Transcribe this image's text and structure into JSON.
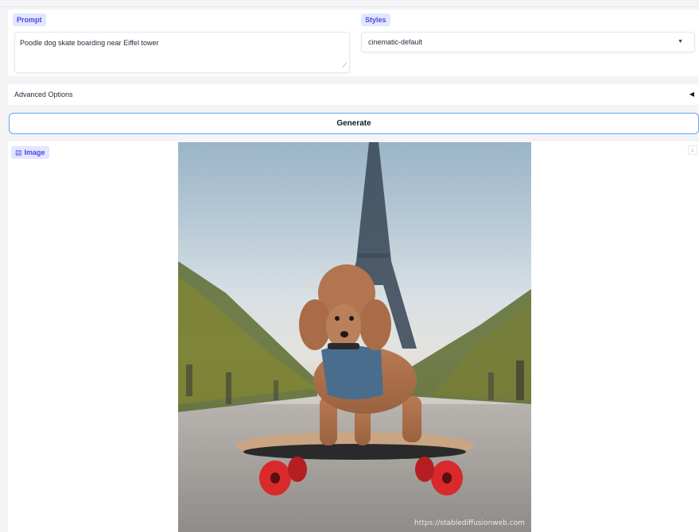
{
  "prompt": {
    "label": "Prompt",
    "value": "Poodle dog skate boarding near Eiffel tower"
  },
  "styles": {
    "label": "Styles",
    "selected": "cinematic-default"
  },
  "advanced": {
    "label": "Advanced Options"
  },
  "actions": {
    "generate_label": "Generate"
  },
  "output": {
    "label": "Image",
    "image_description_icon": "image-icon",
    "watermark": "https://stablediffusionweb.com"
  },
  "colors": {
    "accent": "#4f46e5",
    "chip_bg": "#e0e7ff",
    "button_border": "#60a5fa"
  }
}
